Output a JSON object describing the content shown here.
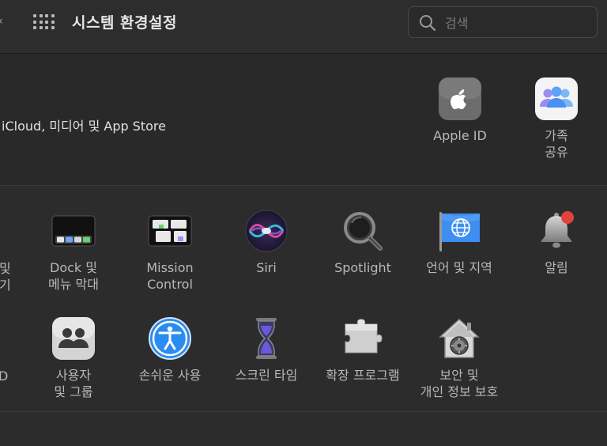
{
  "toolbar": {
    "title": "시스템 환경설정",
    "search_placeholder": "검색"
  },
  "account": {
    "subtitle": "iCloud, 미디어 및 App Store",
    "items": [
      {
        "label": "Apple ID",
        "icon": "apple-id-icon"
      },
      {
        "label": "가족\n공유",
        "icon": "family-sharing-icon"
      }
    ]
  },
  "row1": [
    {
      "label": "Dock 및\n메뉴 막대",
      "icon": "dock-icon"
    },
    {
      "label": "Mission\nControl",
      "icon": "mission-control-icon"
    },
    {
      "label": "Siri",
      "icon": "siri-icon"
    },
    {
      "label": "Spotlight",
      "icon": "spotlight-icon"
    },
    {
      "label": "언어 및 지역",
      "icon": "language-region-icon"
    },
    {
      "label": "알림",
      "icon": "notifications-icon"
    }
  ],
  "row1_edge": "및\n기",
  "row2": [
    {
      "label": "사용자\n및 그룹",
      "icon": "users-groups-icon"
    },
    {
      "label": "손쉬운 사용",
      "icon": "accessibility-icon"
    },
    {
      "label": "스크린 타임",
      "icon": "screen-time-icon"
    },
    {
      "label": "확장 프로그램",
      "icon": "extensions-icon"
    },
    {
      "label": "보안 및\n개인 정보 보호",
      "icon": "security-privacy-icon"
    }
  ],
  "row2_edge": "D",
  "colors": {
    "window_bg": "#2d2c2d",
    "banner_bg": "#2a292a",
    "text": "#b8b8b8",
    "notification_badge": "#e0443a"
  }
}
